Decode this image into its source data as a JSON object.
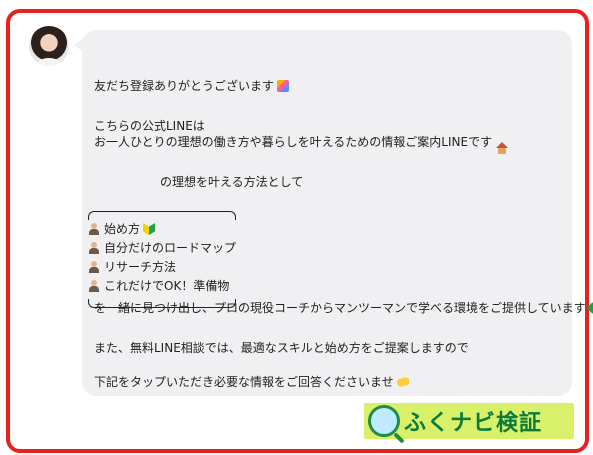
{
  "message": {
    "line1": "友だち登録ありがとうございます",
    "line2": "こちらの公式LINEは",
    "line3": "お一人ひとりの理想の働き方や暮らしを叶えるための情報ご案内LINEです",
    "line4": "の理想を叶える方法として",
    "list": [
      "始め方",
      "自分だけのロードマップ",
      "リサーチ方法",
      "これだけでOK！準備物"
    ],
    "line5": "を一緒に見つけ出し、プロの現役コーチからマンツーマンで学べる環境をご提供しています",
    "line6": "また、無料LINE相談では、最適なスキルと始め方をご提案しますので",
    "line7": "下記をタップいただき必要な情報をご回答くださいませ"
  },
  "watermark": {
    "text": "ふくナビ検証"
  },
  "icons": {
    "avatar": "avatar",
    "party": "party-popper-icon",
    "house": "house-icon",
    "person": "person-icon",
    "beginner": "beginner-mark-icon",
    "clover": "clover-icon",
    "hands": "raised-hands-icon",
    "logo": "magnifier-leaf-icon"
  },
  "colors": {
    "frame": "#e8201f",
    "bubble": "#f0f0f2",
    "logo_bg": "#d8f06a",
    "logo_text": "#0b7b3b"
  }
}
